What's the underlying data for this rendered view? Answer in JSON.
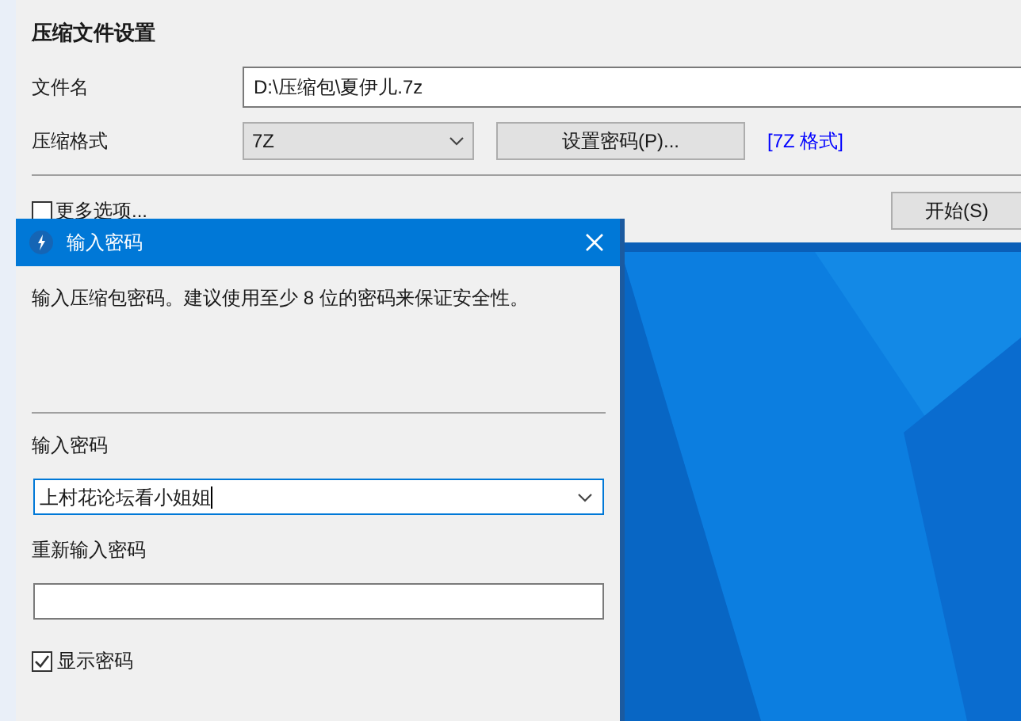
{
  "settings_window": {
    "title": "压缩文件设置",
    "file_name": {
      "label": "文件名",
      "value": "D:\\压缩包\\夏伊儿.7z"
    },
    "format": {
      "label": "压缩格式",
      "value": "7Z"
    },
    "set_password_button": "设置密码(P)...",
    "format_link": "[7Z 格式]",
    "more_options": {
      "label": "更多选项...",
      "checked": false
    },
    "start_button": "开始(S)"
  },
  "password_dialog": {
    "title": "输入密码",
    "description": "输入压缩包密码。建议使用至少 8 位的密码来保证安全性。",
    "fields": [
      {
        "label": "输入密码",
        "value": "上村花论坛看小姐姐",
        "kind": "combo",
        "focused": true
      },
      {
        "label": "重新输入密码",
        "kind": "text",
        "focused": false
      }
    ],
    "show_password": {
      "label": "显示密码",
      "checked": true
    }
  }
}
